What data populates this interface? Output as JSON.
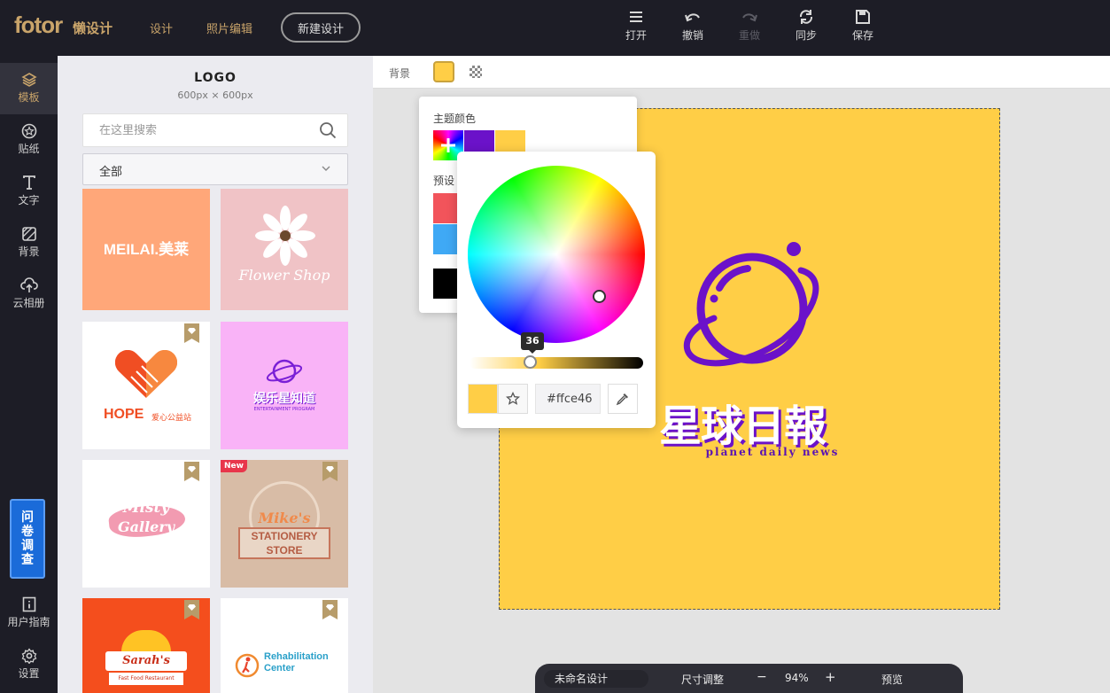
{
  "topbar": {
    "brand": "fotor",
    "brand_sub": "懒设计",
    "nav": [
      "设计",
      "照片编辑"
    ],
    "new_design": "新建设计",
    "tools": [
      {
        "icon": "menu-icon",
        "label": "打开",
        "enabled": true
      },
      {
        "icon": "undo-icon",
        "label": "撤销",
        "enabled": true
      },
      {
        "icon": "redo-icon",
        "label": "重做",
        "enabled": false
      },
      {
        "icon": "sync-icon",
        "label": "同步",
        "enabled": true
      },
      {
        "icon": "save-icon",
        "label": "保存",
        "enabled": true
      }
    ]
  },
  "sidebar": {
    "items": [
      {
        "icon": "layers-icon",
        "label": "模板",
        "active": true
      },
      {
        "icon": "sticker-icon",
        "label": "贴纸",
        "active": false
      },
      {
        "icon": "text-icon",
        "label": "文字",
        "active": false
      },
      {
        "icon": "background-icon",
        "label": "背景",
        "active": false
      },
      {
        "icon": "cloud-upload-icon",
        "label": "云相册",
        "active": false
      }
    ],
    "survey": [
      "问",
      "卷",
      "调",
      "查"
    ],
    "guide": "用户指南",
    "settings": "设置"
  },
  "panel": {
    "title": "LOGO",
    "size": "600px × 600px",
    "search_placeholder": "在这里搜索",
    "category": "全部",
    "templates": [
      {
        "name": "meilai",
        "text": "MEILAI.美莱",
        "premium": false,
        "new": false
      },
      {
        "name": "flower-shop",
        "text": "Flower Shop",
        "premium": false,
        "new": false
      },
      {
        "name": "hope",
        "text": "HOPE",
        "text2": "爱心公益站",
        "premium": true,
        "new": false
      },
      {
        "name": "planet-purple",
        "text": "娱乐星知道",
        "text2": "ENTERTAINMENT PROGRAM",
        "premium": false,
        "new": false
      },
      {
        "name": "misty-gallery",
        "text": "Misty",
        "text2": "Gallery",
        "premium": true,
        "new": false
      },
      {
        "name": "mikes-stationery",
        "text": "Mike's",
        "text2": "STATIONERY",
        "text3": "STORE",
        "premium": true,
        "new": true,
        "badge": "New"
      },
      {
        "name": "sarahs",
        "text": "Sarah's",
        "text2": "Fast Food Restaurant",
        "premium": true,
        "new": false
      },
      {
        "name": "rehab",
        "text": "Rehabilitation",
        "text2": "Center",
        "premium": true,
        "new": false
      }
    ]
  },
  "options": {
    "label": "背景",
    "bg_color": "#ffce46"
  },
  "colorpop": {
    "theme_label": "主题颜色",
    "theme_colors": [
      "#6b12c9",
      "#ffce46"
    ],
    "preset_label": "预设",
    "preset_colors": [
      "#f2545b",
      "#3fa9f5",
      "#000000"
    ],
    "slider_value": "36",
    "hex": "#ffce46",
    "current": "#ffce46"
  },
  "canvas": {
    "bg": "#ffce46",
    "logo_cn": "星球日報",
    "logo_en": "planet  daily news",
    "accent": "#6b12c9"
  },
  "bottombar": {
    "name": "未命名设计",
    "resize": "尺寸调整",
    "minus": "−",
    "zoom": "94%",
    "plus": "+",
    "preview": "预览"
  }
}
